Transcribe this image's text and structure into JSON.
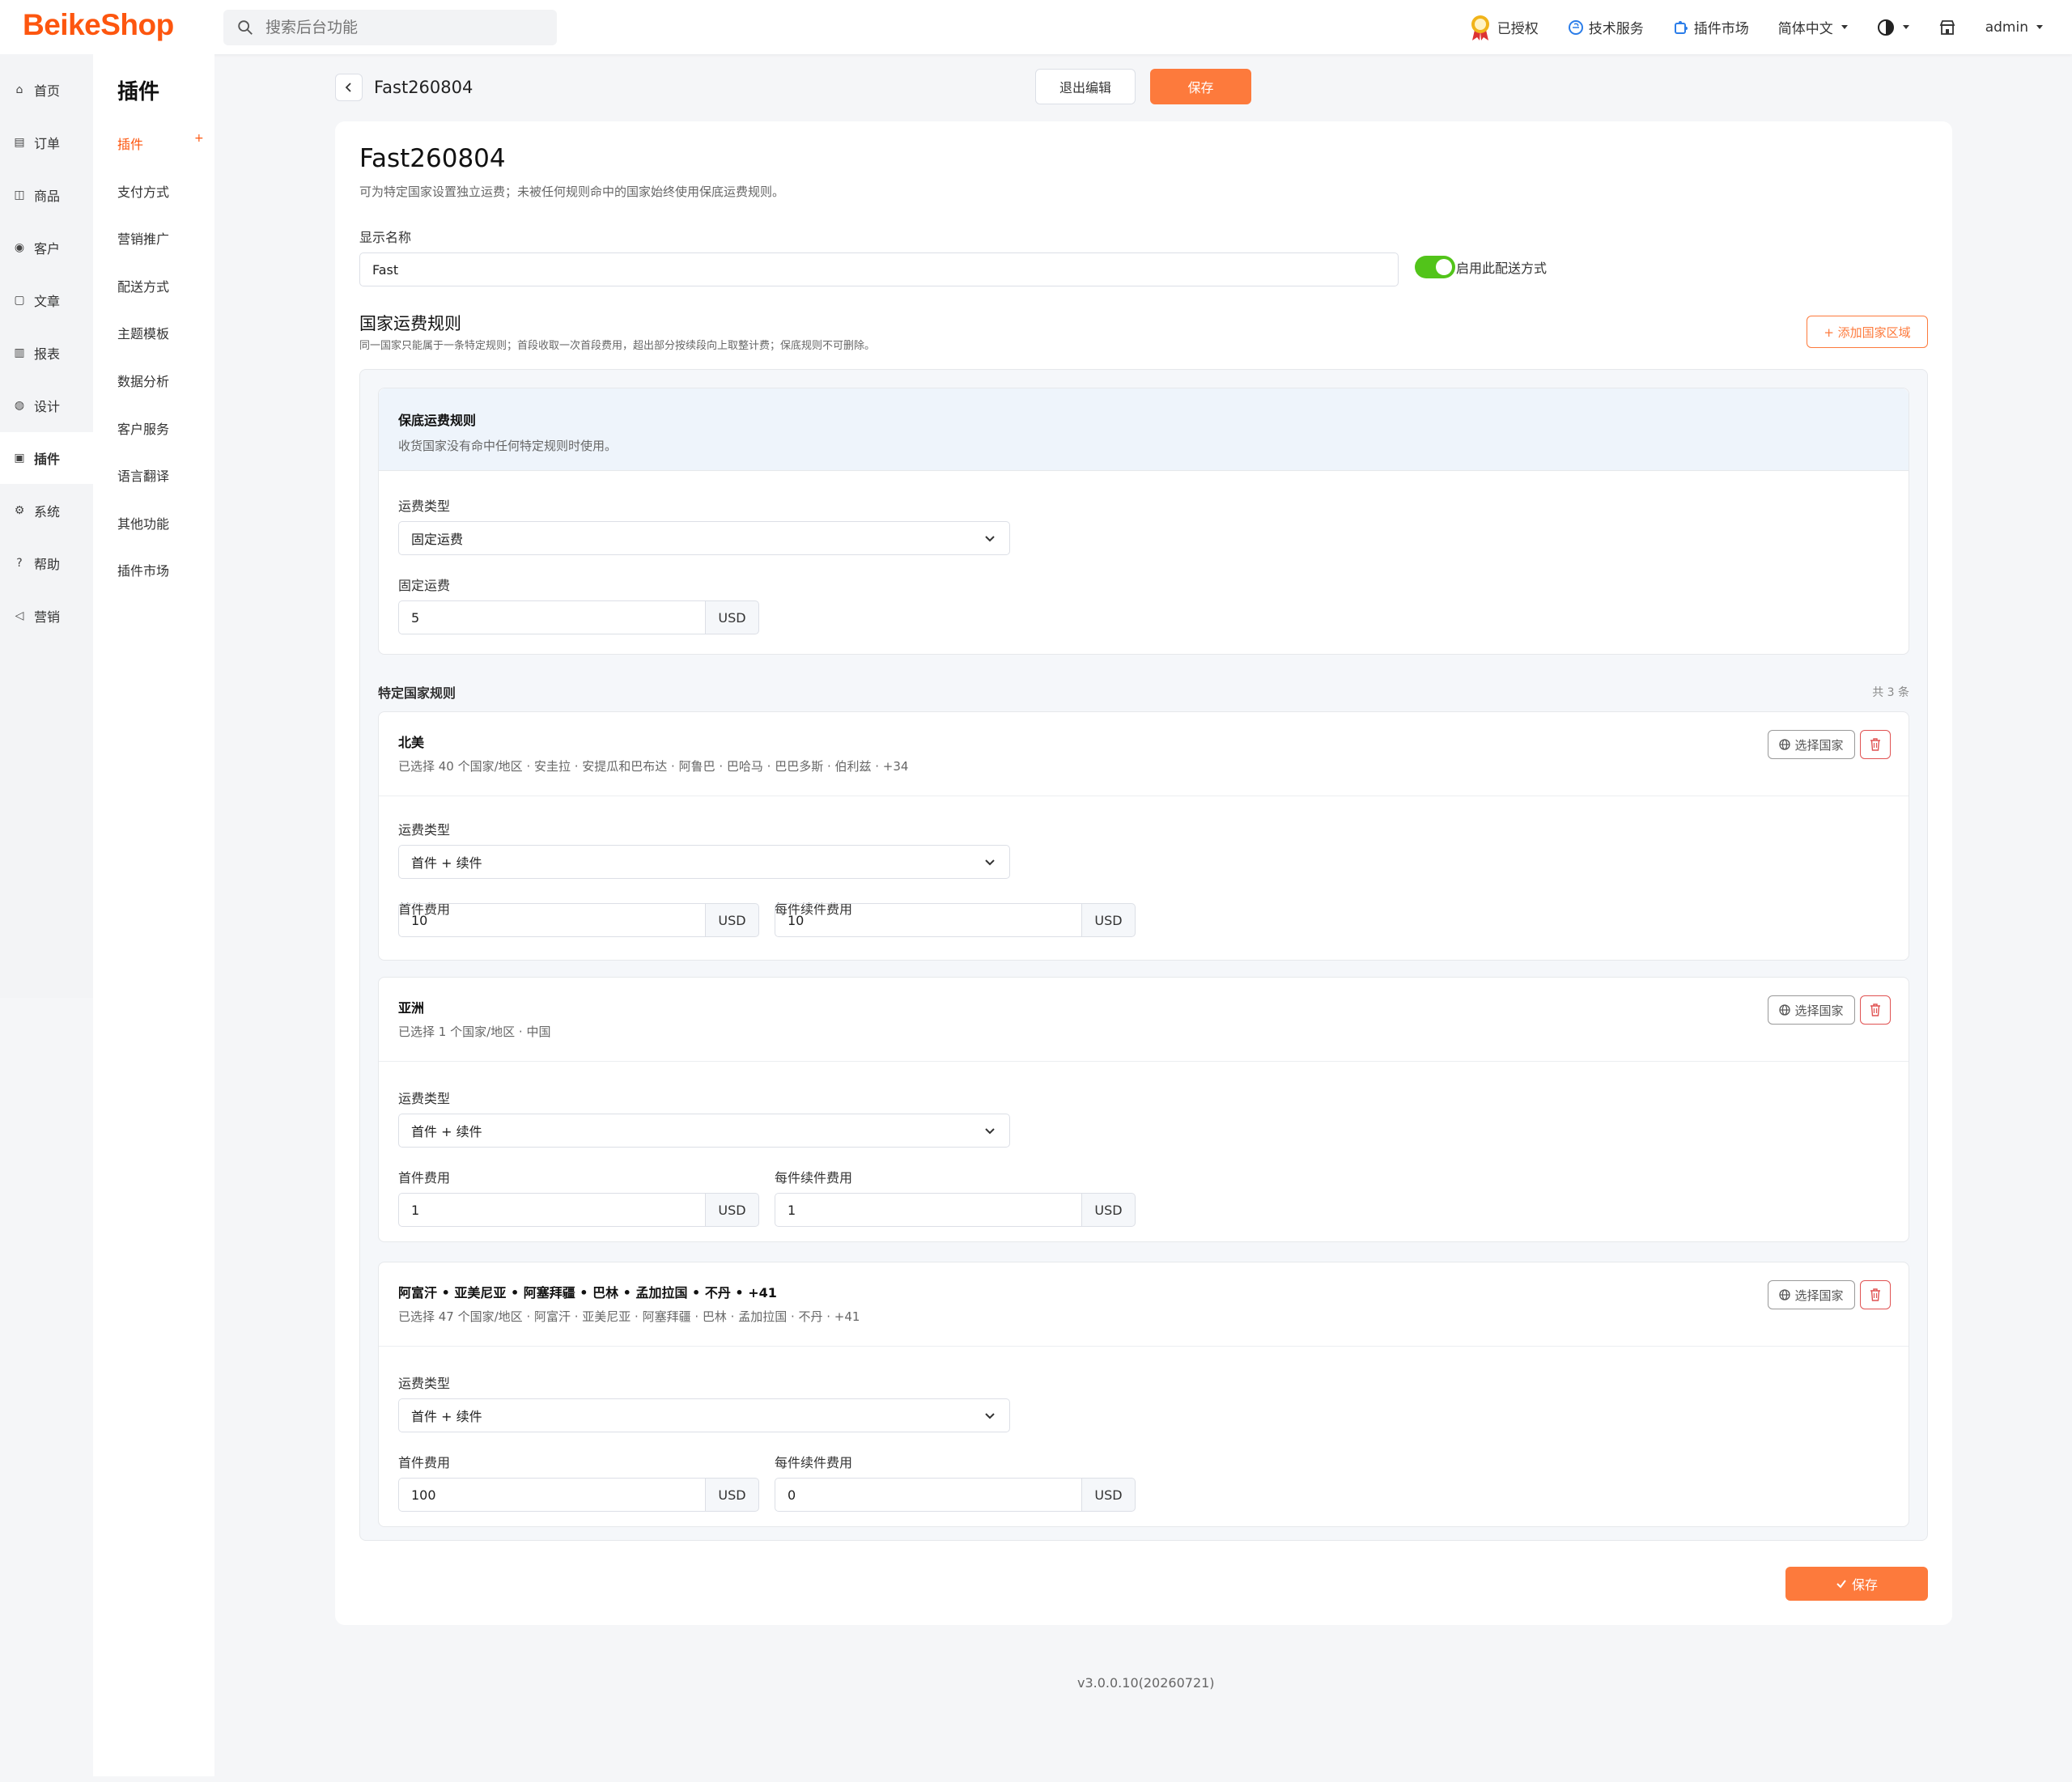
{
  "topbar": {
    "logo": "BeikeShop",
    "search_placeholder": "搜索后台功能",
    "licensed": "已授权",
    "tech_service": "技术服务",
    "plugin_market": "插件市场",
    "language": "简体中文",
    "user": "admin"
  },
  "sidebar": {
    "items": [
      "首页",
      "订单",
      "商品",
      "客户",
      "文章",
      "报表",
      "设计",
      "插件",
      "系统",
      "帮助",
      "营销"
    ],
    "active_index": 7
  },
  "subnav": {
    "title": "插件",
    "items": [
      "插件",
      "支付方式",
      "营销推广",
      "配送方式",
      "主题模板",
      "数据分析",
      "客户服务",
      "语言翻译",
      "其他功能",
      "插件市场"
    ],
    "active_index": 0
  },
  "header": {
    "title": "Fast260804",
    "exit_label": "退出编辑",
    "save_label": "保存"
  },
  "form": {
    "title": "Fast260804",
    "description": "可为特定国家设置独立运费；未被任何规则命中的国家始终使用保底运费规则。",
    "display_name_label": "显示名称",
    "display_name_value": "Fast",
    "enable_label": "启用此配送方式",
    "enabled": true,
    "rules_title": "国家运费规则",
    "rules_desc": "同一国家只能属于一条特定规则；首段收取一次首段费用，超出部分按续段向上取整计费；保底规则不可删除。",
    "add_region_label": "+ 添加国家区域",
    "fallback": {
      "title": "保底运费规则",
      "desc": "收货国家没有命中任何特定规则时使用。",
      "type_label": "运费类型",
      "type_value": "固定运费",
      "fixed_label": "固定运费",
      "fixed_value": "5",
      "unit": "USD"
    },
    "specific_title": "特定国家规则",
    "specific_count": "共 3 条",
    "select_country_label": "选择国家",
    "first_fee_label": "首件费用",
    "extra_fee_label": "每件续件费用",
    "type_label": "运费类型",
    "unit": "USD",
    "rules": [
      {
        "name": "北美",
        "countries": "已选择 40 个国家/地区 · 安圭拉 · 安提瓜和巴布达 · 阿鲁巴 · 巴哈马 · 巴巴多斯 · 伯利兹 · +34",
        "type": "首件 + 续件",
        "first": "10",
        "extra": "10"
      },
      {
        "name": "亚洲",
        "countries": "已选择 1 个国家/地区 · 中国",
        "type": "首件 + 续件",
        "first": "1",
        "extra": "1"
      },
      {
        "name": "阿富汗 • 亚美尼亚 • 阿塞拜疆 • 巴林 • 孟加拉国 • 不丹 • +41",
        "countries": "已选择 47 个国家/地区 · 阿富汗 · 亚美尼亚 · 阿塞拜疆 · 巴林 · 孟加拉国 · 不丹 · +41",
        "type": "首件 + 续件",
        "first": "100",
        "extra": "0"
      }
    ],
    "bottom_save_label": "保存"
  },
  "footer": {
    "version": "v3.0.0.10(20260721)"
  },
  "colors": {
    "accent": "#fd7a3c",
    "brand": "#fd560f",
    "toggle_on": "#52c41a"
  }
}
